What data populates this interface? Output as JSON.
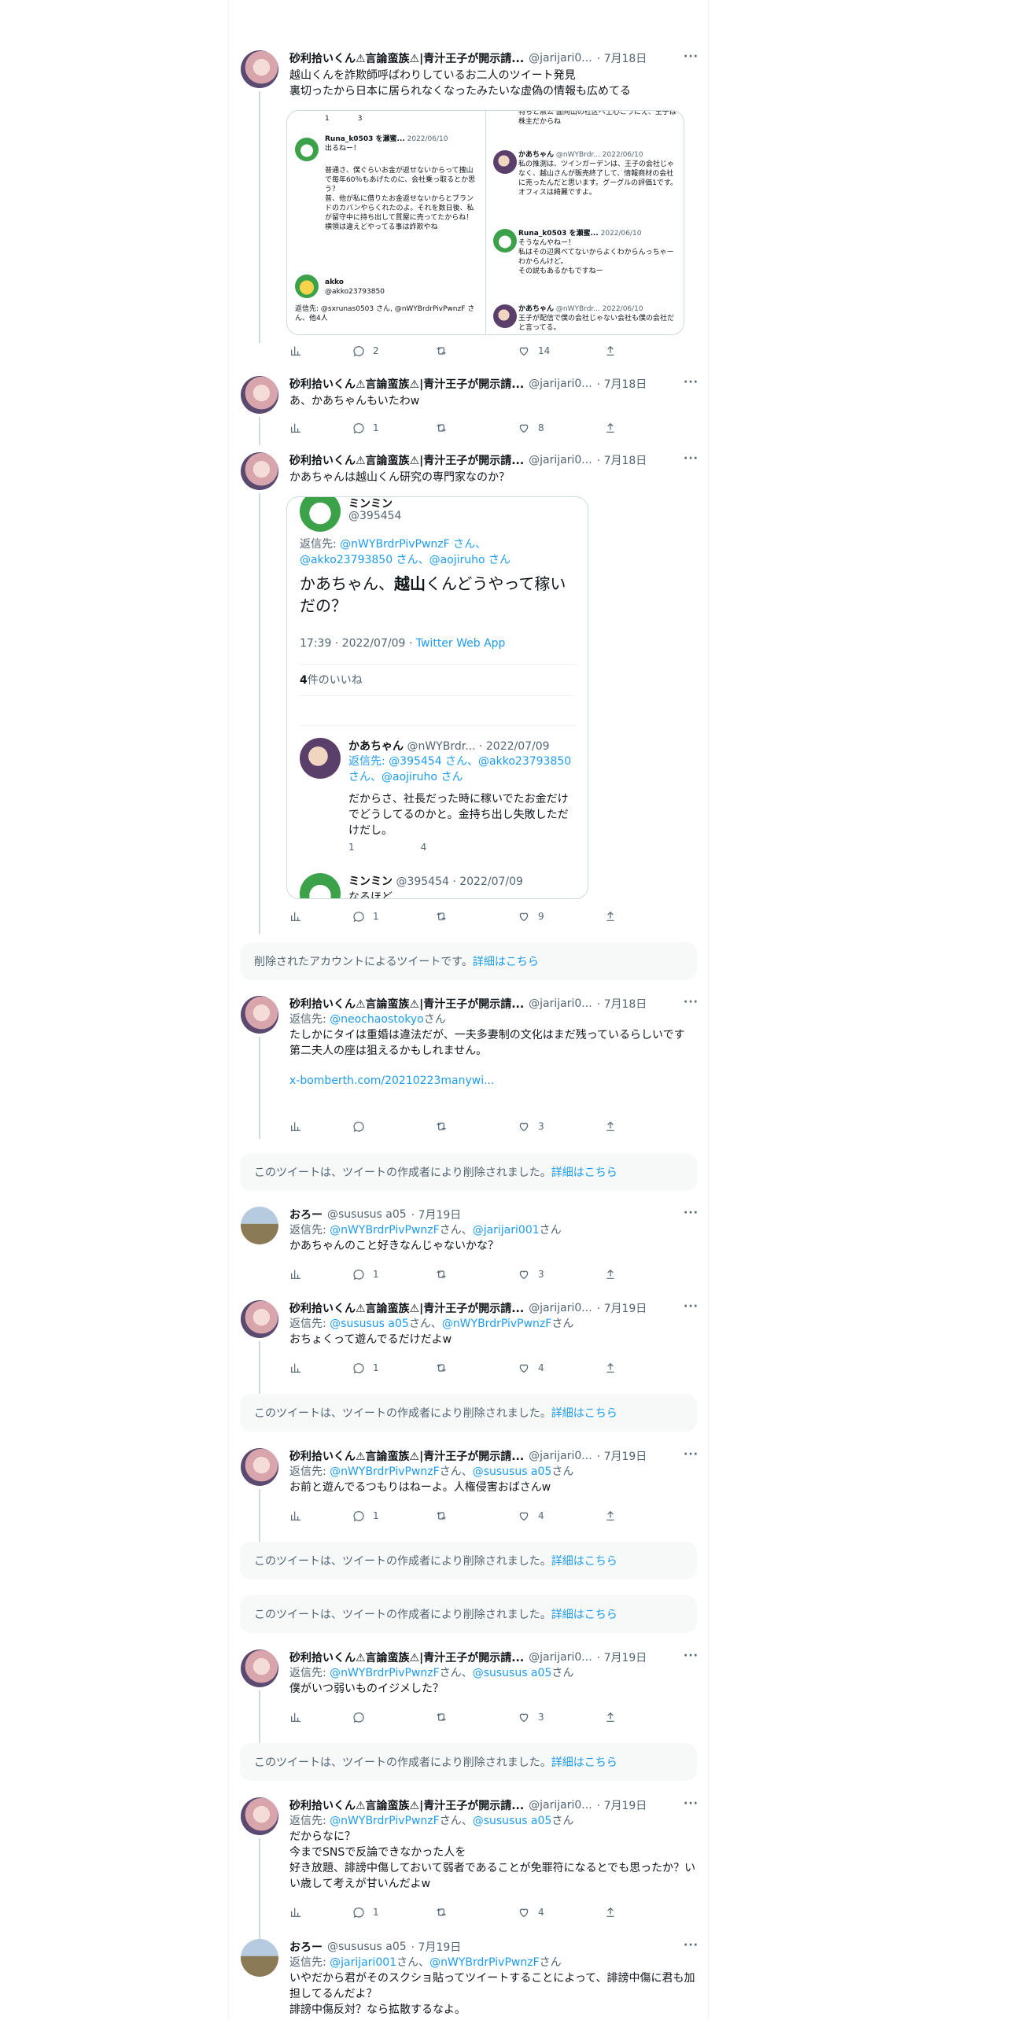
{
  "tweets": [
    {
      "name": "砂利拾いくん⚠言論蛮族⚠|青汁王子が開示請...",
      "handle": "@jarijari0...",
      "date": "· 7月18日",
      "text": "越山くんを詐欺師呼ばわりしているお二人のツイート発見\n裏切ったから日本に居られなくなったみたいな虚偽の情報も広めてる",
      "stats": {
        "reply": "2",
        "retweet": "",
        "like": "14"
      }
    },
    {
      "name": "砂利拾いくん⚠言論蛮族⚠|青汁王子が開示請...",
      "handle": "@jarijari0...",
      "date": "· 7月18日",
      "text": "あ、かあちゃんもいたわw",
      "stats": {
        "reply": "1",
        "retweet": "",
        "like": "8"
      }
    },
    {
      "name": "砂利拾いくん⚠言論蛮族⚠|青汁王子が開示請...",
      "handle": "@jarijari0...",
      "date": "· 7月18日",
      "text": "かあちゃんは越山くん研究の専門家なのか？",
      "stats": {
        "reply": "1",
        "retweet": "",
        "like": "9"
      }
    },
    {
      "name": "砂利拾いくん⚠言論蛮族⚠|青汁王子が開示請...",
      "handle": "@jarijari0...",
      "date": "· 7月18日",
      "reply_prefix": "返信先: ",
      "reply_to": "@neochaostokyo",
      "reply_suffix": "さん",
      "text": "たしかにタイは重婚は違法だが、一夫多妻制の文化はまだ残っているらしいです\n第二夫人の座は狙えるかもしれません。",
      "link": "x-bomberth.com/20210223manywi...",
      "stats": {
        "reply": "",
        "retweet": "",
        "like": "3"
      }
    },
    {
      "name": "おろー",
      "handle": "@sususus a05",
      "date": "· 7月19日",
      "reply_prefix": "返信先: ",
      "reply_to": "@nWYBrdrPivPwnzF",
      "reply_mid": "さん、",
      "reply_to2": "@jarijari001",
      "reply_suffix": "さん",
      "text": "かあちゃんのこと好きなんじゃないかな？",
      "stats": {
        "reply": "1",
        "retweet": "",
        "like": "3"
      }
    },
    {
      "name": "砂利拾いくん⚠言論蛮族⚠|青汁王子が開示請...",
      "handle": "@jarijari0...",
      "date": "· 7月19日",
      "reply_prefix": "返信先: ",
      "reply_to": "@sususus a05",
      "reply_mid": "さん、",
      "reply_to2": "@nWYBrdrPivPwnzF",
      "reply_suffix": "さん",
      "text": "おちょくって遊んでるだけだよw",
      "stats": {
        "reply": "1",
        "retweet": "",
        "like": "4"
      }
    },
    {
      "name": "砂利拾いくん⚠言論蛮族⚠|青汁王子が開示請...",
      "handle": "@jarijari0...",
      "date": "· 7月19日",
      "reply_prefix": "返信先: ",
      "reply_to": "@nWYBrdrPivPwnzF",
      "reply_mid": "さん、",
      "reply_to2": "@sususus a05",
      "reply_suffix": "さん",
      "text": "お前と遊んでるつもりはねーよ。人権侵害おばさんw",
      "stats": {
        "reply": "1",
        "retweet": "",
        "like": "4"
      }
    },
    {
      "name": "砂利拾いくん⚠言論蛮族⚠|青汁王子が開示請...",
      "handle": "@jarijari0...",
      "date": "· 7月19日",
      "reply_prefix": "返信先: ",
      "reply_to": "@nWYBrdrPivPwnzF",
      "reply_mid": "さん、",
      "reply_to2": "@sususus a05",
      "reply_suffix": "さん",
      "text": "僕がいつ弱いものイジメした？",
      "stats": {
        "reply": "",
        "retweet": "",
        "like": "3"
      }
    },
    {
      "name": "砂利拾いくん⚠言論蛮族⚠|青汁王子が開示請...",
      "handle": "@jarijari0...",
      "date": "· 7月19日",
      "reply_prefix": "返信先: ",
      "reply_to": "@nWYBrdrPivPwnzF",
      "reply_mid": "さん、",
      "reply_to2": "@sususus a05",
      "reply_suffix": "さん",
      "text": "だからなに？\n今までSNSで反論できなかった人を\n好き放題、誹謗中傷しておいて弱者であることが免罪符になるとでも思ったか？いい歳して考えが甘いんだよw",
      "stats": {
        "reply": "1",
        "retweet": "",
        "like": "4"
      }
    },
    {
      "name": "おろー",
      "handle": "@sususus a05",
      "date": "· 7月19日",
      "reply_prefix": "返信先: ",
      "reply_to": "@jarijari001",
      "reply_mid": "さん、",
      "reply_to2": "@nWYBrdrPivPwnzF",
      "reply_suffix": "さん",
      "text": "いやだから君がそのスクショ貼ってツイートすることによって、誹謗中傷に君も加担してるんだよ？\n誹謗中傷反対？なら拡散するなよ。"
    }
  ],
  "deleted": {
    "account_text": "削除されたアカウントによるツイートです。",
    "author_text": "このツイートは、ツイートの作成者により削除されました。",
    "link": "詳細はこちら"
  },
  "embed1": {
    "left_top_stats": [
      "1",
      "",
      "3"
    ],
    "runa_name": "Runa_k0503 を瀬蜜...",
    "runa_date": "2022/06/10",
    "runa_text1": "出るねー！",
    "runa_text2": "普通さ、僕ぐらいお金が返せないからって捜山で毎年60％もあげたのに、会社乗っ取るとか思う？\n普、他が私に借りたお金返せないからとブランドのカバンやらくれたのよ。それを数日後、私が留守中に持ち出して質屋に売ってたからね！\n横領は違えどやってる事は詐欺やね",
    "akko_name": "akko",
    "akko_handle": "@akko23793850",
    "akko_reply": "返信先: @sxrunas0503 さん, @nWYBrdrPivPwnzF さん、他4人",
    "right_top_text": "特ちと無公 面同山の社区へ上心こうにえ、王子は株主だからね",
    "kaa_name": "かあちゃん",
    "kaa_handle": "@nWYBrdr...",
    "kaa_date": "2022/06/10",
    "kaa_text": "私の推測は、ツインガーデンは、王子の会社じゃなく、越山さんが販売終了して、情報商材の会社に売ったんだと思います。グーグルの評価1です。オフィスは綺麗ですよ。",
    "runa2_name": "Runa_k0503 を瀬蜜...",
    "runa2_date": "2022/06/10",
    "runa2_text": "そうなんやねー！\n私はその辺興べてないからよくわからんっちゃーわからんけど。\nその説もあるかもですねー",
    "kaa2_name": "かあちゃん",
    "kaa2_handle": "@nWYBrdr...",
    "kaa2_date": "2022/06/10",
    "kaa2_text": "王子が配信で僕の会社じゃない会社も僕の会社だと言ってる。"
  },
  "embed2": {
    "name": "ミンミン",
    "handle": "@395454",
    "reply_prefix": "返信先: ",
    "reply_users": "@nWYBrdrPivPwnzF さん、@akko23793850 さん、@aojiruho さん",
    "text_a": "かあちゃん、",
    "text_bold": "越山",
    "text_b": "くんどうやって稼いだの？",
    "time": "17:39 · 2022/07/09 · ",
    "client": "Twitter Web App",
    "likes_num": "4",
    "likes_label": "件のいいね",
    "reply_name": "かあちゃん",
    "reply_handle": "@nWYBrdr... · 2022/07/09",
    "reply_to": "返信先: @395454 さん、@akko23793850 さん、@aojiruho さん",
    "reply_text": "だからさ、社長だった時に稼いでたお金だけでどうしてるのかと。金持ち出し失敗しただけだし。",
    "reply_reply": "1",
    "reply_up": "4",
    "next_name": "ミンミン",
    "next_handle": "@395454 · 2022/07/09",
    "next_text": "なるほど"
  },
  "colors": {
    "accent": "#1d9bf0",
    "muted": "#536471",
    "border": "#cfd9de"
  }
}
